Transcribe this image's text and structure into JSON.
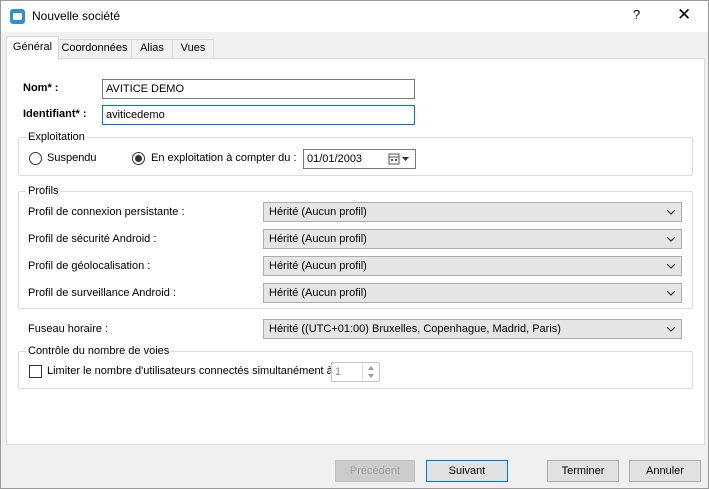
{
  "window": {
    "title": "Nouvelle société",
    "help_label": "?",
    "close_label": "✕"
  },
  "tabs": [
    {
      "label": "Général",
      "active": true
    },
    {
      "label": "Coordonnées",
      "active": false
    },
    {
      "label": "Alias",
      "active": false
    },
    {
      "label": "Vues",
      "active": false
    }
  ],
  "general": {
    "nom_label": "Nom* :",
    "nom_value": "AVITICE DEMO",
    "identifiant_label": "Identifiant* :",
    "identifiant_value": "aviticedemo"
  },
  "exploitation": {
    "title": "Exploitation",
    "suspendu_label": "Suspendu",
    "suspendu_checked": false,
    "en_exploitation_label": "En exploitation à compter du :",
    "en_exploitation_checked": true,
    "date_value": "01/01/2003"
  },
  "profils": {
    "title": "Profils",
    "rows": [
      {
        "label": "Profil de connexion persistante :",
        "value": "Hérité (Aucun profil)"
      },
      {
        "label": "Profil de sécurité Android :",
        "value": "Hérité (Aucun profil)"
      },
      {
        "label": "Profil de géolocalisation :",
        "value": "Hérité (Aucun profil)"
      },
      {
        "label": "Profil de surveillance Android :",
        "value": "Hérité (Aucun profil)"
      }
    ]
  },
  "fuseau": {
    "label": "Fuseau horaire :",
    "value": "Hérité ((UTC+01:00) Bruxelles, Copenhague, Madrid, Paris)"
  },
  "voies": {
    "title": "Contrôle du nombre de voies",
    "checkbox_label": "Limiter le nombre d'utilisateurs connectés simultanément à",
    "checked": false,
    "spin_value": "1"
  },
  "buttons": {
    "precedent": "Précédent",
    "suivant": "Suivant",
    "terminer": "Terminer",
    "annuler": "Annuler"
  },
  "colors": {
    "accent": "#0078d7",
    "app_icon": "#2d8fd5"
  }
}
